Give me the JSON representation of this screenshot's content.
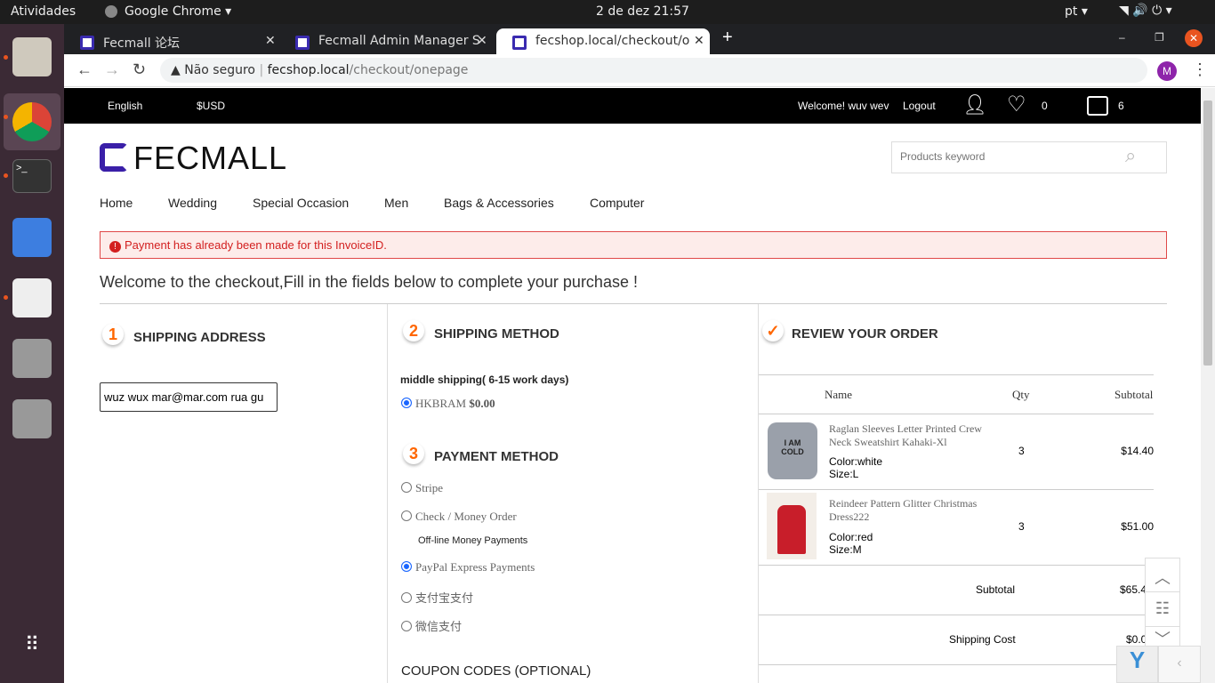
{
  "os": {
    "activities": "Atividades",
    "app": "Google Chrome",
    "clock": "2 de dez  21:57",
    "lang": "pt"
  },
  "browser": {
    "tabs": [
      {
        "label": "Fecmall 论坛"
      },
      {
        "label": "Fecmall Admin Manager S"
      },
      {
        "label": "fecshop.local/checkout/o"
      }
    ],
    "security": "Não seguro",
    "url_host": "fecshop.local",
    "url_path": "/checkout/onepage",
    "profile": "M"
  },
  "header": {
    "language": "English",
    "currency": "$USD",
    "welcome": "Welcome! wuv wev",
    "logout": "Logout",
    "wishlist_count": "0",
    "cart_count": "6"
  },
  "logo": "FECMALL",
  "search": {
    "placeholder": "Products keyword"
  },
  "nav": [
    "Home",
    "Wedding",
    "Special Occasion",
    "Men",
    "Bags & Accessories",
    "Computer"
  ],
  "alert": "Payment has already been made for this InvoiceID.",
  "title": "Welcome to the checkout,Fill in the fields below to complete your purchase !",
  "shipping_address": {
    "step": "1",
    "title": "SHIPPING ADDRESS",
    "selected": "wuz wux mar@mar.com rua gu"
  },
  "shipping_method": {
    "step": "2",
    "title": "SHIPPING METHOD",
    "group": "middle shipping( 6-15 work days)",
    "option": "HKBRAM",
    "price": "$0.00"
  },
  "payment_method": {
    "step": "3",
    "title": "PAYMENT METHOD",
    "options": [
      "Stripe",
      "Check / Money Order",
      "PayPal Express Payments",
      "支付宝支付",
      "微信支付"
    ],
    "note": "Off-line Money Payments",
    "selected": "PayPal Express Payments"
  },
  "coupon": {
    "title": "COUPON CODES (OPTIONAL)"
  },
  "review": {
    "title": "REVIEW YOUR ORDER",
    "columns": [
      "Name",
      "Qty",
      "Subtotal"
    ],
    "items": [
      {
        "name": "Raglan Sleeves Letter Printed Crew Neck Sweatshirt Kahaki-Xl",
        "color": "Color:white",
        "size": "Size:L",
        "qty": "3",
        "subtotal": "$14.40"
      },
      {
        "name": "Reindeer Pattern Glitter Christmas Dress222",
        "color": "Color:red",
        "size": "Size:M",
        "qty": "3",
        "subtotal": "$51.00"
      }
    ],
    "subtotal_label": "Subtotal",
    "subtotal": "$65.4",
    "shipping_label": "Shipping Cost",
    "shipping": "$0.0"
  }
}
